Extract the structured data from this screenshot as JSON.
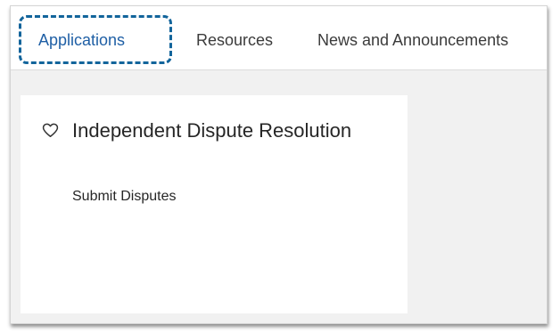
{
  "tabs": [
    {
      "label": "Applications",
      "active": true
    },
    {
      "label": "Resources",
      "active": false
    },
    {
      "label": "News and Announcements",
      "active": false
    }
  ],
  "card": {
    "title": "Independent Dispute Resolution",
    "favorite_icon": "heart-outline-icon",
    "link_label": "Submit Disputes"
  },
  "colors": {
    "accent": "#1f5fa5",
    "focus_ring": "#12649b",
    "background": "#f1f1f1",
    "card": "#ffffff"
  }
}
